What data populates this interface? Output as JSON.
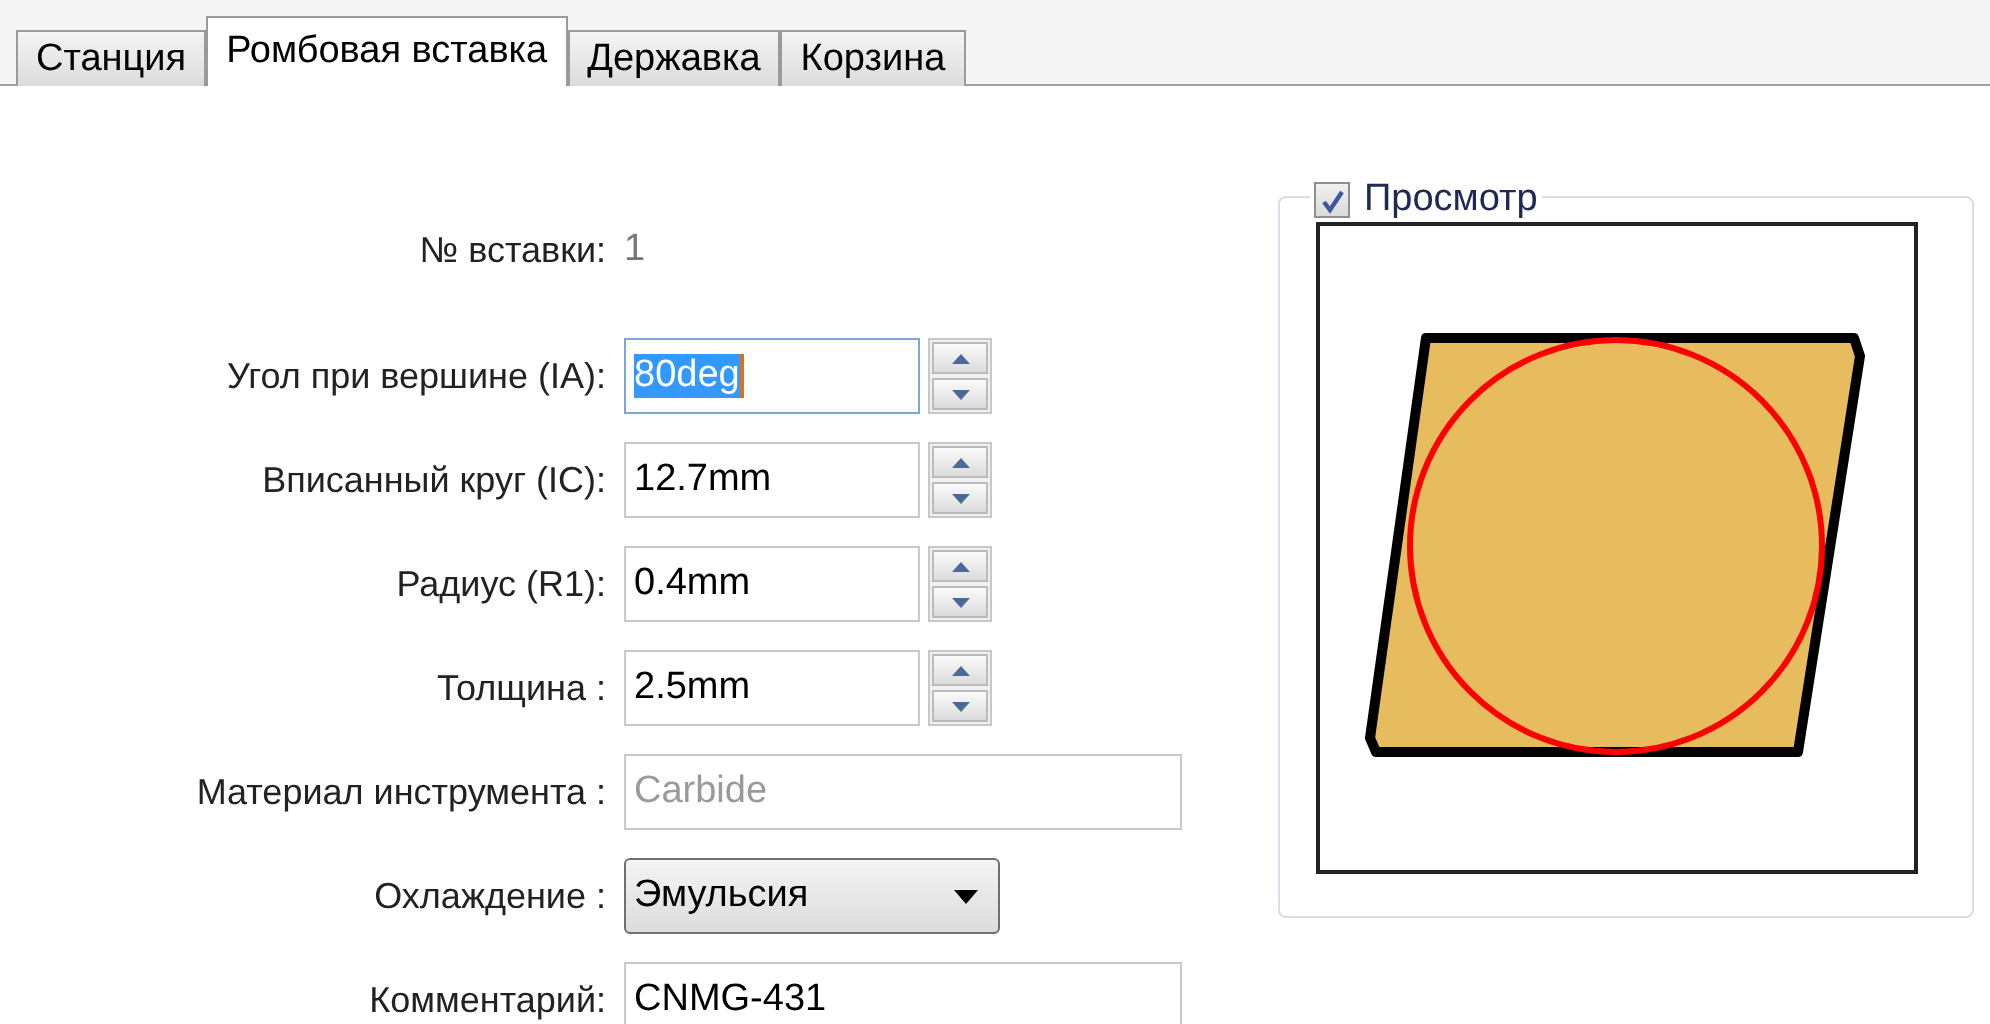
{
  "tabs": [
    {
      "label": "Станция",
      "selected": false
    },
    {
      "label": "Ромбовая вставка",
      "selected": true
    },
    {
      "label": "Державка",
      "selected": false
    },
    {
      "label": "Корзина",
      "selected": false
    }
  ],
  "insert_number": {
    "label": "№ вставки:",
    "value": "1"
  },
  "fields": [
    {
      "kind": "spin",
      "label": "Угол при вершине (IA):",
      "value": "80deg",
      "focused": true
    },
    {
      "kind": "spin",
      "label": "Вписанный круг (IC):",
      "value": "12.7mm",
      "focused": false
    },
    {
      "kind": "spin",
      "label": "Радиус (R1):",
      "value": "0.4mm",
      "focused": false
    },
    {
      "kind": "spin",
      "label": "Толщина :",
      "value": "2.5mm",
      "focused": false
    },
    {
      "kind": "text",
      "label": "Материал инструмента :",
      "value": "Carbide",
      "disabled": true
    },
    {
      "kind": "select",
      "label": "Охлаждение :",
      "value": "Эмульсия"
    },
    {
      "kind": "text",
      "label": "Комментарий:",
      "value": "CNMG-431",
      "disabled": false
    }
  ],
  "preview": {
    "label": "Просмотр",
    "checked": true
  }
}
